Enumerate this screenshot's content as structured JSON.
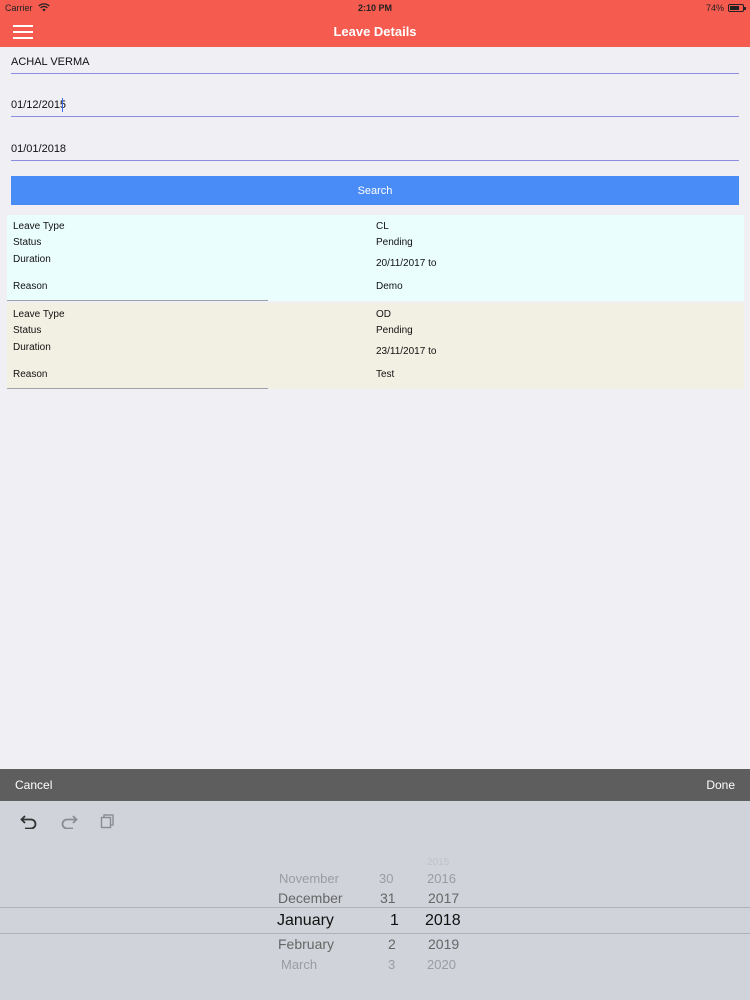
{
  "status_bar": {
    "carrier": "Carrier",
    "time": "2:10 PM",
    "battery": "74%"
  },
  "nav": {
    "title": "Leave Details"
  },
  "form": {
    "name": "ACHAL VERMA",
    "from_date": "01/12/2015",
    "to_date": "01/01/2018",
    "search_label": "Search"
  },
  "labels": {
    "leave_type": "Leave Type",
    "status": "Status",
    "duration": "Duration",
    "reason": "Reason"
  },
  "leaves": [
    {
      "type": "CL",
      "status": "Pending",
      "duration": "20/11/2017 to",
      "reason": "Demo",
      "bg": "#eafefd"
    },
    {
      "type": "OD",
      "status": "Pending",
      "duration": "23/11/2017 to",
      "reason": "Test",
      "bg": "#f2efe3"
    }
  ],
  "picker": {
    "cancel": "Cancel",
    "done": "Done",
    "months": [
      "November",
      "December",
      "January",
      "February",
      "March"
    ],
    "days": [
      "30",
      "31",
      "1",
      "2",
      "3"
    ],
    "years": [
      "2015",
      "2016",
      "2017",
      "2018",
      "2019",
      "2020"
    ]
  },
  "colors": {
    "nav": "#f55b4f",
    "button": "#4a8cf7",
    "toolbar": "#5e5e5e"
  },
  "icons": {
    "menu": "hamburger-icon",
    "wifi": "wifi-icon",
    "battery": "battery-icon",
    "undo": "undo-icon",
    "redo": "redo-icon",
    "paste": "paste-icon"
  }
}
